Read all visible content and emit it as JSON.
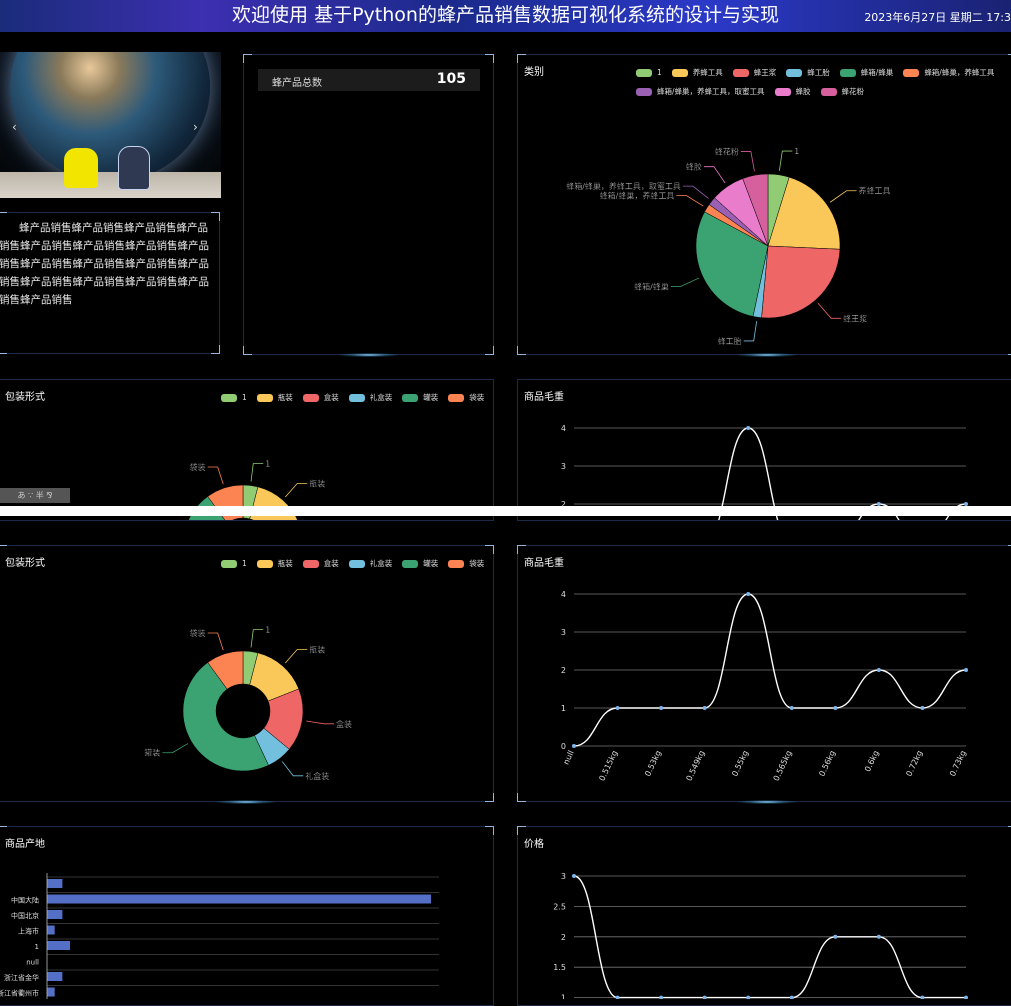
{
  "header": {
    "title": "欢迎使用 基于Python的蜂产品销售数据可视化系统的设计与实现",
    "datetime": "2023年6月27日 星期二 17:3"
  },
  "carousel": {
    "prev": "‹",
    "next": "›"
  },
  "intro": {
    "text": "蜂产品销售蜂产品销售蜂产品销售蜂产品销售蜂产品销售蜂产品销售蜂产品销售蜂产品销售蜂产品销售蜂产品销售蜂产品销售蜂产品销售蜂产品销售蜂产品销售蜂产品销售蜂产品销售蜂产品销售"
  },
  "stat": {
    "label": "蜂产品总数",
    "value": "105"
  },
  "thumb_text": "あ ∵ 半 ⅋ ",
  "colors": [
    "#91cc75",
    "#fac858",
    "#ee6666",
    "#73c0de",
    "#3ba272",
    "#fc8452",
    "#9a60b4",
    "#ea7ccc",
    "#d6609d"
  ],
  "chart_data": [
    {
      "id": "category-pie",
      "type": "pie",
      "title": "类别",
      "legend": [
        "1",
        "养蜂工具",
        "蜂王浆",
        "蜂工胎",
        "蜂箱/蜂巢",
        "蜂箱/蜂巢，养蜂工具",
        "蜂箱/蜂巢，养蜂工具，取蜜工具",
        "蜂胶",
        "蜂花粉"
      ],
      "slices": [
        {
          "name": "1",
          "value": 5
        },
        {
          "name": "养蜂工具",
          "value": 22
        },
        {
          "name": "蜂王浆",
          "value": 27
        },
        {
          "name": "蜂工胎",
          "value": 2
        },
        {
          "name": "蜂箱/蜂巢",
          "value": 31
        },
        {
          "name": "蜂箱/蜂巢，养蜂工具",
          "value": 2
        },
        {
          "name": "蜂箱/蜂巢，养蜂工具，取蜜工具",
          "value": 2
        },
        {
          "name": "蜂胶",
          "value": 8
        },
        {
          "name": "蜂花粉",
          "value": 6
        }
      ]
    },
    {
      "id": "packaging-donut",
      "type": "pie",
      "title": "包装形式",
      "legend": [
        "1",
        "瓶装",
        "盒装",
        "礼盒装",
        "罐装",
        "袋装"
      ],
      "slices": [
        {
          "name": "1",
          "value": 4
        },
        {
          "name": "瓶装",
          "value": 15
        },
        {
          "name": "盒装",
          "value": 17
        },
        {
          "name": "礼盒装",
          "value": 7
        },
        {
          "name": "罐装",
          "value": 47
        },
        {
          "name": "袋装",
          "value": 10
        }
      ]
    },
    {
      "id": "weight-line",
      "type": "line",
      "title": "商品毛重",
      "categories": [
        "null",
        "0.515kg",
        "0.53kg",
        "0.549kg",
        "0.55kg",
        "0.565kg",
        "0.56kg",
        "0.6kg",
        "0.72kg",
        "0.73kg"
      ],
      "values": [
        0,
        1,
        1,
        1,
        4,
        1,
        1,
        2,
        1,
        2
      ],
      "ylim": [
        0,
        4
      ],
      "yticks": [
        "0",
        "1",
        "2",
        "3",
        "4"
      ]
    },
    {
      "id": "origin-bar",
      "type": "bar",
      "title": "商品产地",
      "categories": [
        "",
        "中国大陆",
        "中国北京",
        "上海市",
        "1",
        "null",
        "浙江省金华",
        "浙江省衢州市"
      ],
      "values": [
        2,
        50,
        2,
        1,
        3,
        0,
        2,
        1
      ],
      "xmax": 50
    },
    {
      "id": "price-line",
      "type": "line",
      "title": "价格",
      "values": [
        3,
        1,
        1,
        1,
        1,
        1,
        2,
        2,
        1,
        1
      ],
      "ylim": [
        0.5,
        3
      ],
      "yticks": [
        "1",
        "1.5",
        "2",
        "2.5",
        "3"
      ]
    }
  ]
}
